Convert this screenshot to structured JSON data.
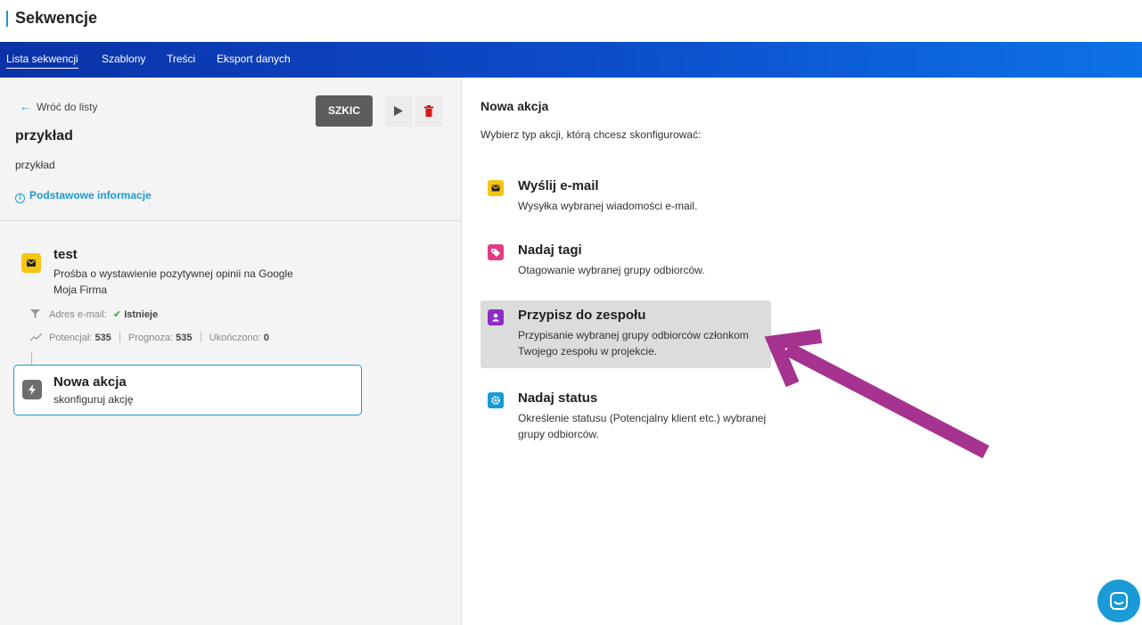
{
  "app": {
    "title": "Sekwencje"
  },
  "nav": {
    "items": [
      "Lista sekwencji",
      "Szablony",
      "Treści",
      "Eksport danych"
    ]
  },
  "left": {
    "back_label": "Wróć do listy",
    "name": "przykład",
    "description": "przykład",
    "info_link": "Podstawowe informacje",
    "status_button": "SZKIC",
    "step": {
      "title": "test",
      "subtitle_line1": "Prośba o wystawienie pozytywnej opinii na Google",
      "subtitle_line2": "Moja Firma",
      "filter_label": "Adres e-mail:",
      "filter_value": "Istnieje",
      "potential_label": "Potencjał:",
      "potential_value": "535",
      "forecast_label": "Prognoza:",
      "forecast_value": "535",
      "completed_label": "Ukończono:",
      "completed_value": "0"
    },
    "new_action": {
      "title": "Nowa akcja",
      "subtitle": "skonfiguruj akcję"
    }
  },
  "right": {
    "title": "Nowa akcja",
    "subtitle": "Wybierz typ akcji, którą chcesz skonfigurować:",
    "options": [
      {
        "title": "Wyślij e-mail",
        "desc": "Wysyłka wybranej wiadomości e-mail.",
        "icon": "envelope-icon",
        "color": "#f6c512"
      },
      {
        "title": "Nadaj tagi",
        "desc": "Otagowanie wybranej grupy odbiorców.",
        "icon": "tag-icon",
        "color": "#e23c86"
      },
      {
        "title": "Przypisz do zespołu",
        "desc": "Przypisanie wybranej grupy odbiorców członkom Twojego zespołu w projekcie.",
        "icon": "person-icon",
        "color": "#8f2bc3"
      },
      {
        "title": "Nadaj status",
        "desc": "Określenie statusu (Potencjalny klient etc.) wybranej grupy odbiorców.",
        "icon": "gear-icon",
        "color": "#1a9ad6"
      }
    ]
  },
  "colors": {
    "accent": "#1a9ad6",
    "nav_start": "#0b32a8",
    "nav_end": "#0d72e6",
    "highlight_arrow": "#a6338f",
    "selected_bg": "#dcdcdc"
  }
}
